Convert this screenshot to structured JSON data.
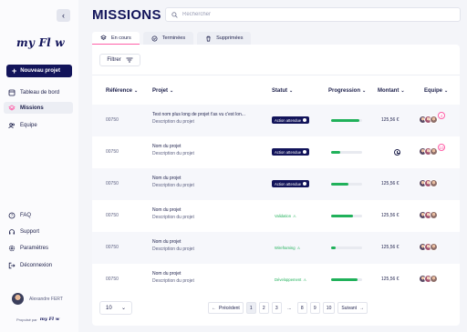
{
  "app": {
    "logo": "my Fl w",
    "title": "MISSIONS"
  },
  "sidebar": {
    "new_project_label": "Nouveau projet",
    "items": [
      {
        "label": "Tableau de bord",
        "icon": "dashboard-icon"
      },
      {
        "label": "Missions",
        "icon": "missions-icon",
        "active": true
      },
      {
        "label": "Equipe",
        "icon": "team-icon"
      }
    ],
    "bottom_items": [
      {
        "label": "FAQ",
        "icon": "help-icon"
      },
      {
        "label": "Support",
        "icon": "headset-icon"
      },
      {
        "label": "Paramètres",
        "icon": "settings-icon"
      },
      {
        "label": "Déconnexion",
        "icon": "logout-icon"
      }
    ],
    "user_name": "Alexandre FERT",
    "powered_by": "Propulsé par",
    "powered_logo": "my Fl w"
  },
  "search": {
    "placeholder": "Rechercher",
    "value": ""
  },
  "tabs": [
    {
      "label": "En cours",
      "icon": "layers-icon",
      "active": true
    },
    {
      "label": "Terminées",
      "icon": "check-circle-icon"
    },
    {
      "label": "Supprimées",
      "icon": "trash-icon"
    }
  ],
  "filter_label": "Filtrer",
  "table": {
    "headers": [
      "Référence",
      "Projet",
      "Statut",
      "Progression",
      "Montant",
      "Equipe"
    ],
    "rows": [
      {
        "ref": "00750",
        "name": "Test nom plus long de projet t'as vu c'est lon...",
        "desc": "Description du projet",
        "status": "Action attendue",
        "status_style": "dark",
        "progress": 0.9,
        "amount": "125,56 €",
        "extra_team": "4",
        "clock": false
      },
      {
        "ref": "00750",
        "name": "Nom du projet",
        "desc": "Description du projet",
        "status": "Action attendue",
        "status_style": "dark",
        "progress": 0.3,
        "amount": "",
        "extra_team": "10",
        "clock": true
      },
      {
        "ref": "00750",
        "name": "Nom du projet",
        "desc": "Description du projet",
        "status": "Action attendue",
        "status_style": "dark",
        "progress": 0.55,
        "amount": "125,56 €",
        "extra_team": "",
        "clock": false
      },
      {
        "ref": "00750",
        "name": "Nom du projet",
        "desc": "Description du projet",
        "status": "Validation",
        "status_style": "light",
        "progress": 0.7,
        "amount": "125,56 €",
        "extra_team": "",
        "clock": false
      },
      {
        "ref": "00750",
        "name": "Nom du projet",
        "desc": "Description du projet",
        "status": "Wireframing",
        "status_style": "light",
        "progress": 0.15,
        "amount": "125,56 €",
        "extra_team": "",
        "clock": false
      },
      {
        "ref": "00750",
        "name": "Nom du projet",
        "desc": "Description du projet",
        "status": "Développement",
        "status_style": "light",
        "progress": 0.85,
        "amount": "125,56 €",
        "extra_team": "",
        "clock": false
      }
    ]
  },
  "pagination": {
    "per_page": "10",
    "prev_label": "Précédent",
    "next_label": "Suivant",
    "pages": [
      "1",
      "2",
      "3",
      "...",
      "8",
      "9",
      "10"
    ],
    "current": "1"
  },
  "colors": {
    "primary": "#12145a",
    "accent": "#ff5fa8",
    "success": "#20b15a"
  }
}
